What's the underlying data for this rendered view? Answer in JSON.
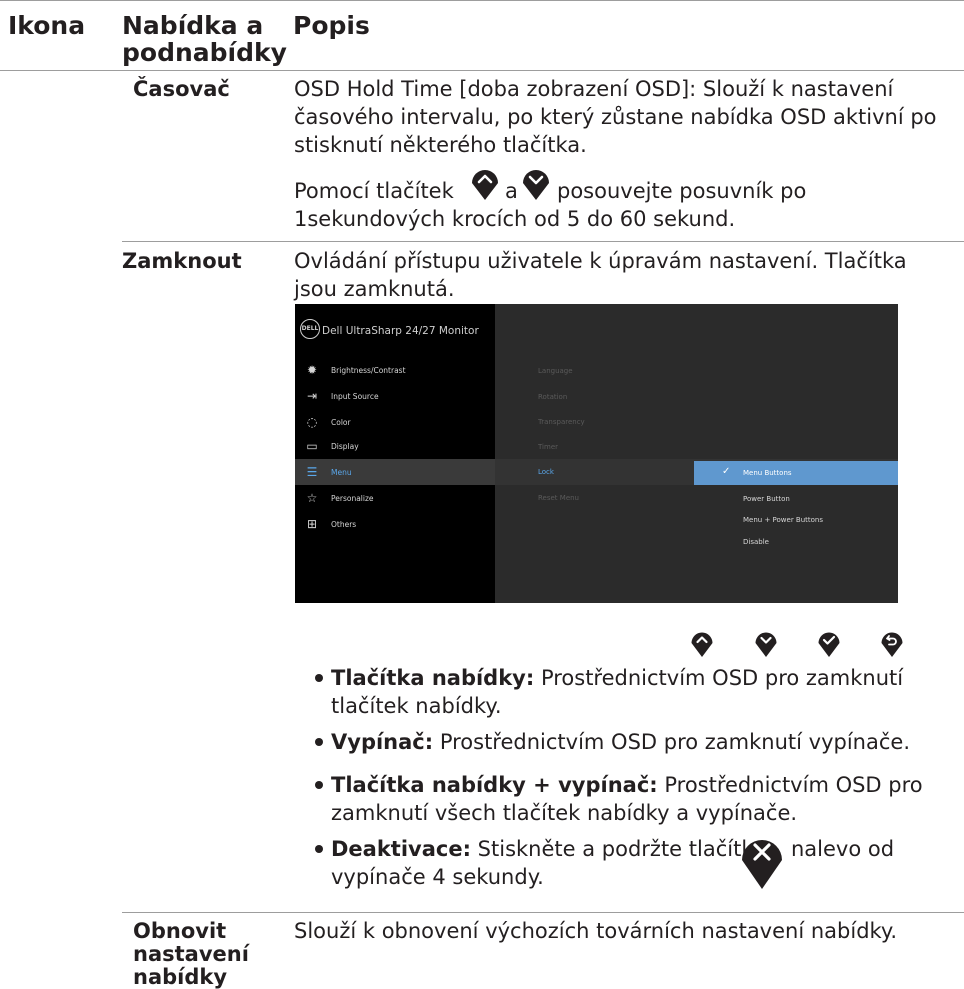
{
  "header": {
    "col_icon": "Ikona",
    "col_menu_l1": "Nabídka a",
    "col_menu_l2": "podnabídky",
    "col_desc": "Popis"
  },
  "timer": {
    "name": "Časovač",
    "desc_l1": "OSD Hold Time [doba zobrazení OSD]: Slouží k nastavení",
    "desc_l2": "časového intervalu, po který zůstane nabídka OSD aktivní po",
    "desc_l3": "stisknutí některého tlačítka.",
    "buttons_before": "Pomocí tlačítek",
    "buttons_and": "a",
    "buttons_after": "posouvejte posuvník po",
    "buttons_l2": "1sekundových krocích od 5 do 60 sekund."
  },
  "lock": {
    "name": "Zamknout",
    "desc_l1": "Ovládání přístupu uživatele k úpravám nastavení. Tlačítka",
    "desc_l2": "jsou zamknutá.",
    "bullets": [
      {
        "term": "Tlačítka nabídky:",
        "text_l1": " Prostřednictvím OSD pro zamknutí",
        "text_l2": "tlačítek nabídky."
      },
      {
        "term": "Vypínač:",
        "text_l1": " Prostřednictvím OSD pro zamknutí vypínače.",
        "text_l2": ""
      },
      {
        "term": "Tlačítka nabídky + vypínač:",
        "text_l1": " Prostřednictvím OSD pro",
        "text_l2": "zamknutí všech tlačítek nabídky a vypínače."
      },
      {
        "term": "Deaktivace:",
        "text_l1": " Stiskněte a podržte tlačítko",
        "text_after": "nalevo od",
        "text_l2": "vypínače 4 sekundy."
      }
    ]
  },
  "reset": {
    "name_l1": "Obnovit",
    "name_l2": "nastavení",
    "name_l3": "nabídky",
    "desc": "Slouží k obnovení výchozích továrních nastavení nabídky."
  },
  "osd": {
    "logo": "DELL",
    "title": "Dell UltraSharp 24/27 Monitor",
    "menu": [
      {
        "label": "Brightness/Contrast",
        "icon": "sun-icon"
      },
      {
        "label": "Input Source",
        "icon": "input-icon"
      },
      {
        "label": "Color",
        "icon": "palette-icon"
      },
      {
        "label": "Display",
        "icon": "monitor-icon"
      },
      {
        "label": "Menu",
        "icon": "menu-icon"
      },
      {
        "label": "Personalize",
        "icon": "star-icon"
      },
      {
        "label": "Others",
        "icon": "others-icon"
      }
    ],
    "submenu": [
      "Language",
      "Rotation",
      "Transparency",
      "Timer",
      "Lock",
      "Reset Menu"
    ],
    "lock_options": [
      "Menu Buttons",
      "Power Button",
      "Menu + Power Buttons",
      "Disable"
    ],
    "colors": {
      "accent": "#5aa7ea",
      "selected_option_bg": "#5f98cf",
      "panel_bg": "#2b2b2b"
    }
  }
}
